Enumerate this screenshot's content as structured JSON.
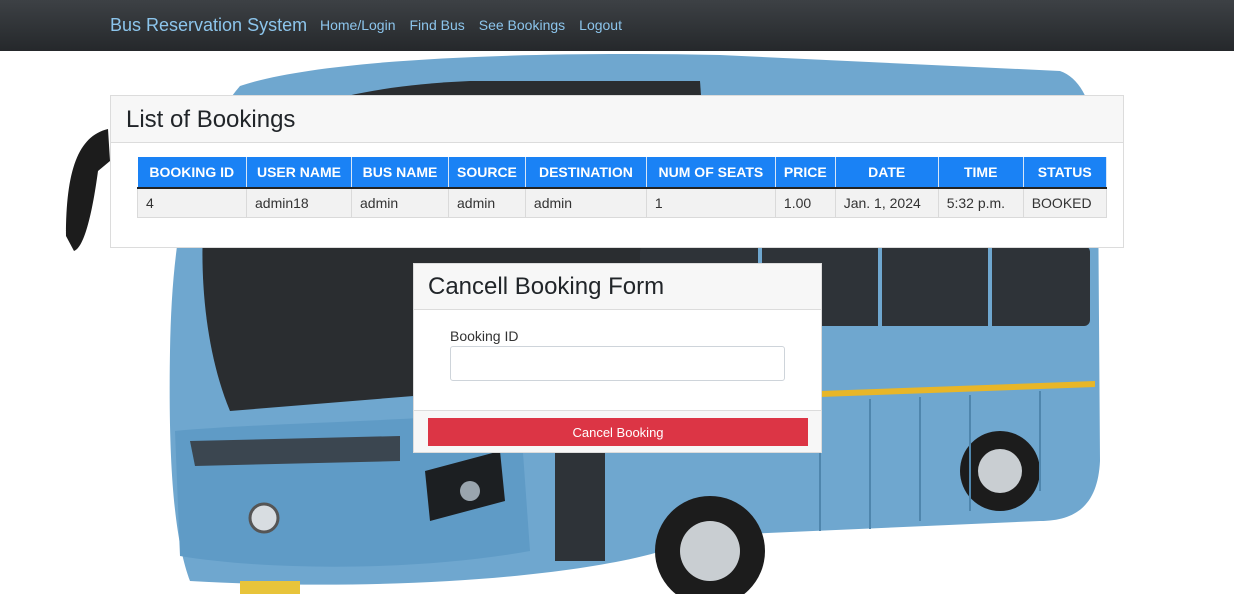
{
  "navbar": {
    "brand": "Bus Reservation System",
    "links": [
      "Home/Login",
      "Find Bus",
      "See Bookings",
      "Logout"
    ]
  },
  "bookings": {
    "title": "List of Bookings",
    "columns": [
      "BOOKING ID",
      "USER NAME",
      "BUS NAME",
      "SOURCE",
      "DESTINATION",
      "NUM OF SEATS",
      "PRICE",
      "DATE",
      "TIME",
      "STATUS"
    ],
    "rows": [
      [
        "4",
        "admin18",
        "admin",
        "admin",
        "admin",
        "1",
        "1.00",
        "Jan. 1, 2024",
        "5:32 p.m.",
        "BOOKED"
      ]
    ]
  },
  "cancel_form": {
    "title": "Cancell Booking Form",
    "field_label": "Booking ID",
    "field_value": "",
    "button_label": "Cancel Booking"
  },
  "colors": {
    "navbar": "#2c2f33",
    "link": "#8cc5ec",
    "table_header": "#1a82f5",
    "danger": "#dc3545",
    "bus_body": "#6fa7cf"
  }
}
